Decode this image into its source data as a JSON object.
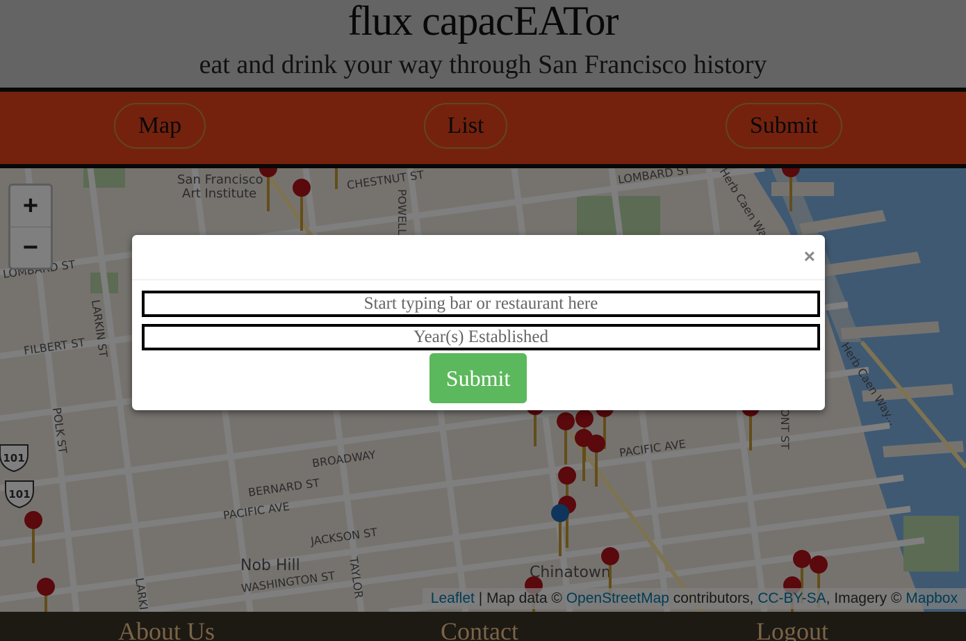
{
  "header": {
    "title": "flux capacEATor",
    "subtitle": "eat and drink your way through San Francisco history"
  },
  "nav": {
    "map_label": "Map",
    "list_label": "List",
    "submit_label": "Submit"
  },
  "map": {
    "zoom_in": "+",
    "zoom_out": "−",
    "labels": {
      "chestnut": "CHESTNUT ST",
      "lombard_right": "LOMBARD ST",
      "lombard_left": "LOMBARD ST",
      "art_institute_1": "San Francisco",
      "art_institute_2": "Art Institute",
      "powell": "POWELL",
      "larkin": "LARKIN ST",
      "larkin_bottom": "LARKI",
      "filbert": "FILBERT ST",
      "polk": "POLK ST",
      "broadway": "BROADWAY",
      "bernard": "BERNARD ST",
      "pacific_left": "PACIFIC AVE",
      "pacific_right": "PACIFIC AVE",
      "jackson": "JACKSON ST",
      "nob_hill": "Nob Hill",
      "washington": "WASHINGTON ST",
      "taylor": "TAYLOR",
      "chinatown": "Chinatown",
      "herb_caen_1": "Herb Caen Wa",
      "herb_caen_2": "Herb Caen Way...",
      "front": "ONT ST",
      "us101_a": "101",
      "us101_b": "101"
    },
    "attribution": {
      "leaflet": "Leaflet",
      "sep": " | Map data © ",
      "osm": "OpenStreetMap",
      "contributors": " contributors, ",
      "ccbysa": "CC-BY-SA",
      "imagery": ", Imagery © ",
      "mapbox": "Mapbox"
    }
  },
  "modal": {
    "close": "×",
    "name_placeholder": "Start typing bar or restaurant here",
    "year_placeholder": "Year(s) Established",
    "submit_label": "Submit"
  },
  "footer": {
    "about": "About Us",
    "contact": "Contact",
    "logout": "Logout"
  },
  "colors": {
    "nav_bg": "#e8451d",
    "pin_red": "#b5121b",
    "pin_blue": "#1e6bb8",
    "submit_green": "#5cb85c",
    "water": "#7fb3e6"
  }
}
